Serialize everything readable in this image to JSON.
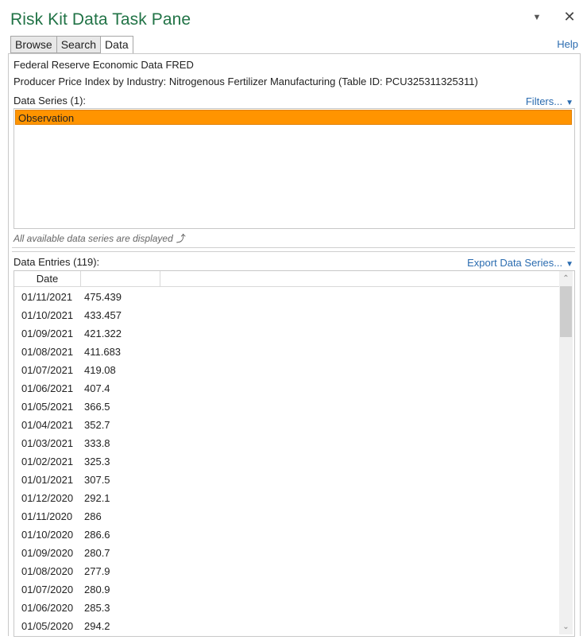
{
  "pane": {
    "title": "Risk Kit Data Task Pane",
    "menu_glyph": "▼",
    "close_glyph": "✕",
    "help_label": "Help"
  },
  "tabs": [
    {
      "label": "Browse",
      "active": false
    },
    {
      "label": "Search",
      "active": false
    },
    {
      "label": "Data",
      "active": true
    }
  ],
  "source": {
    "name": "Federal Reserve Economic Data FRED",
    "table": "Producer Price Index by Industry: Nitrogenous Fertilizer Manufacturing (Table ID: PCU325311325311)"
  },
  "series_section": {
    "label": "Data Series (1):",
    "filters_label": "Filters...",
    "items": [
      "Observation"
    ],
    "hint": "All available data series are displayed"
  },
  "entries_section": {
    "label": "Data Entries (119):",
    "export_label": "Export Data Series...",
    "columns": [
      "Date",
      ""
    ],
    "rows": [
      [
        "01/11/2021",
        "475.439"
      ],
      [
        "01/10/2021",
        "433.457"
      ],
      [
        "01/09/2021",
        "421.322"
      ],
      [
        "01/08/2021",
        "411.683"
      ],
      [
        "01/07/2021",
        "419.08"
      ],
      [
        "01/06/2021",
        "407.4"
      ],
      [
        "01/05/2021",
        "366.5"
      ],
      [
        "01/04/2021",
        "352.7"
      ],
      [
        "01/03/2021",
        "333.8"
      ],
      [
        "01/02/2021",
        "325.3"
      ],
      [
        "01/01/2021",
        "307.5"
      ],
      [
        "01/12/2020",
        "292.1"
      ],
      [
        "01/11/2020",
        "286"
      ],
      [
        "01/10/2020",
        "286.6"
      ],
      [
        "01/09/2020",
        "280.7"
      ],
      [
        "01/08/2020",
        "277.9"
      ],
      [
        "01/07/2020",
        "280.9"
      ],
      [
        "01/06/2020",
        "285.3"
      ],
      [
        "01/05/2020",
        "294.2"
      ]
    ]
  },
  "colors": {
    "title": "#217346",
    "link": "#2b6cb0",
    "selection": "#ff9400"
  }
}
